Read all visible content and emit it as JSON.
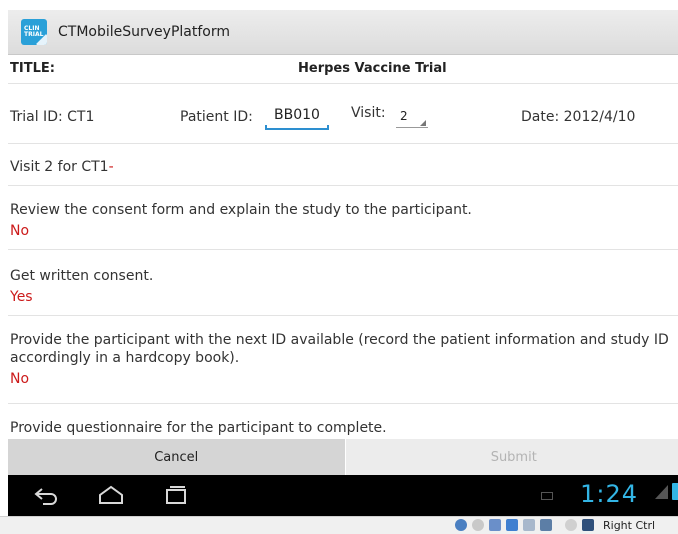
{
  "app": {
    "title": "CTMobileSurveyPlatform",
    "logo_text_top": "CLIN",
    "logo_text_bottom": "TRIAL"
  },
  "form": {
    "title_label": "TITLE:",
    "title_value": "Herpes Vaccine Trial",
    "trial_id": "Trial ID: CT1",
    "patient_id_label": "Patient ID:",
    "patient_id_value": "BB010",
    "visit_label": "Visit:",
    "visit_value": "2",
    "date": "Date: 2012/4/10"
  },
  "section": {
    "heading": "Visit 2 for CT1",
    "heading_suffix": "-"
  },
  "questions": [
    {
      "text": "Review the consent form and explain the study to the participant.",
      "answer": "No"
    },
    {
      "text": "Get written consent.",
      "answer": "Yes"
    },
    {
      "text": "Provide the participant with the next ID available (record the patient information and study ID accordingly in a hardcopy book).",
      "answer": "No"
    },
    {
      "text": "Provide questionnaire for the participant to complete.",
      "answer": ""
    }
  ],
  "buttons": {
    "cancel": "Cancel",
    "submit": "Submit"
  },
  "system": {
    "clock": "1:24",
    "host_key": "Right Ctrl"
  },
  "colors": {
    "accent": "#33b5e5",
    "answer": "#cc1a1a",
    "input_underline": "#2d8fd0"
  }
}
